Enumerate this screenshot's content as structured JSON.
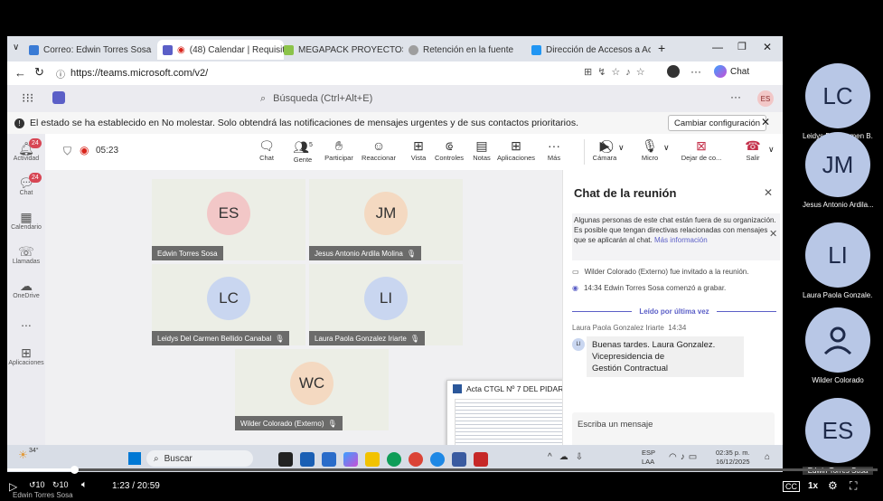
{
  "browser": {
    "tabs": [
      {
        "label": "Correo: Edwin Torres Sosa",
        "color": "#3a7bd5"
      },
      {
        "label": "(48) Calendar | Requisit",
        "color": "#5b5fc7",
        "active": true
      },
      {
        "label": "MEGAPACK PROYECTOS DE",
        "color": "#8bc34a"
      },
      {
        "label": "Retención en la fuente",
        "color": "#9e9e9e"
      },
      {
        "label": "Dirección de Accesos a Acti",
        "color": "#2196f3"
      }
    ],
    "url": "https://teams.microsoft.com/v2/",
    "chat_label": "Chat"
  },
  "teams": {
    "search_placeholder": "Búsqueda (Ctrl+Alt+E)",
    "user_initials": "ES",
    "notice": "El estado se ha establecido en No molestar. Solo obtendrá las notificaciones de mensajes urgentes y de sus contactos prioritarios.",
    "notice_button": "Cambiar configuración",
    "rail": [
      {
        "label": "Actividad",
        "badge": "24"
      },
      {
        "label": "Chat",
        "badge": "24"
      },
      {
        "label": "Calendario"
      },
      {
        "label": "Llamadas"
      },
      {
        "label": "OneDrive"
      },
      {
        "label": "..."
      },
      {
        "label": "Aplicaciones"
      }
    ],
    "timer": "05:23",
    "people_count": "5",
    "tools": [
      "Chat",
      "Gente",
      "Participar",
      "Reaccionar",
      "Vista",
      "Controles",
      "Notas",
      "Aplicaciones",
      "Más"
    ],
    "device_tools": [
      "Cámara",
      "Micro",
      "Dejar de co...",
      "Salir"
    ]
  },
  "tiles": [
    {
      "initials": "ES",
      "name": "Edwin Torres Sosa",
      "color": "#f2c7c7"
    },
    {
      "initials": "JM",
      "name": "Jesus Antonio Ardila Molina",
      "color": "#f4d9c1"
    },
    {
      "initials": "LC",
      "name": "Leidys Del Carmen Bellido Canabal",
      "color": "#c9d6f0"
    },
    {
      "initials": "LI",
      "name": "Laura Paola Gonzalez Iriarte",
      "color": "#c9d6f0"
    },
    {
      "initials": "WC",
      "name": "Wilder Colorado (Externo)",
      "color": "#f4d9c1"
    }
  ],
  "preview": {
    "title": "Acta CTGL Nº 7 DEL PIDAR..."
  },
  "chat": {
    "title": "Chat de la reunión",
    "warning": "Algunas personas de este chat están fuera de su organización. Es posible que tengan directivas relacionadas con mensajes que se aplicarán al chat.",
    "warning_link": "Más información",
    "events": [
      "Wilder Colorado (Externo) fue invitado a la reunión.",
      "14:34  Edwin Torres Sosa comenzó a grabar."
    ],
    "read_marker": "Leído por última vez",
    "message_author": "Laura Paola Gonzalez Iriarte",
    "message_time": "14:34",
    "message_initials": "LI",
    "message_lines": [
      "Buenas tardes. Laura Gonzalez.",
      "Vicepresidencia de",
      "Gestión  Contractual"
    ],
    "compose_placeholder": "Escriba un mensaje"
  },
  "taskbar": {
    "temp": "34°",
    "search": "Buscar",
    "lang1": "ESP",
    "lang2": "LAA",
    "time": "02:35 p. m.",
    "date": "16/12/2025"
  },
  "video": {
    "progress_fraction": 0.077,
    "time": "1:23 / 20:59",
    "skip_back": "10",
    "skip_fwd": "10",
    "speed": "1x",
    "overlay_name": "Edwin Torres Sosa"
  },
  "participants": [
    {
      "initials": "LC",
      "name": "Leidys Del Carmen B..."
    },
    {
      "initials": "JM",
      "name": "Jesus Antonio Ardila..."
    },
    {
      "initials": "LI",
      "name": "Laura Paola Gonzale..."
    },
    {
      "initials": "",
      "name": "Wilder Colorado"
    },
    {
      "initials": "ES",
      "name": "Edwin Torres Sosa"
    }
  ]
}
